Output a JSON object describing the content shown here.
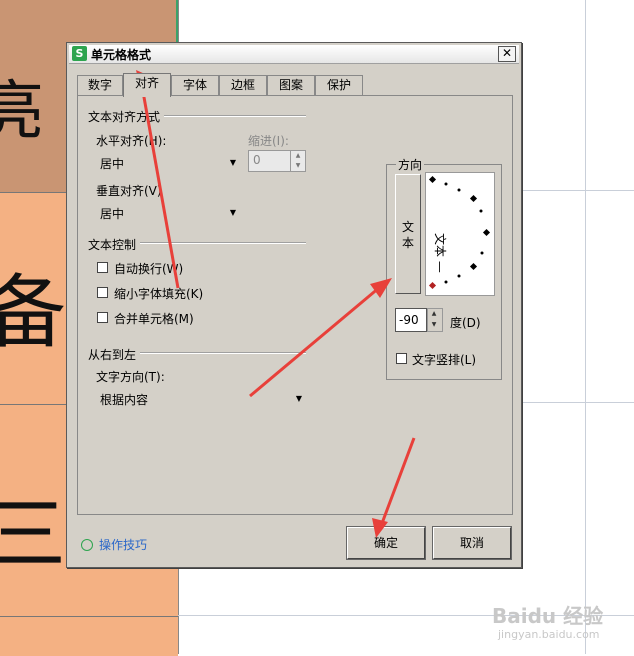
{
  "background": {
    "cells": [
      "亮",
      "备",
      "三"
    ]
  },
  "dialog": {
    "title": "单元格格式",
    "app_icon": "S",
    "close": "✕",
    "tabs": [
      {
        "label": "数字"
      },
      {
        "label": "对齐"
      },
      {
        "label": "字体"
      },
      {
        "label": "边框"
      },
      {
        "label": "图案"
      },
      {
        "label": "保护"
      }
    ],
    "text_alignment": {
      "heading": "文本对齐方式",
      "horizontal_label": "水平对齐(H):",
      "horizontal_value": "居中",
      "indent_label": "缩进(I):",
      "indent_value": "0",
      "vertical_label": "垂直对齐(V)",
      "vertical_value": "居中"
    },
    "text_control": {
      "heading": "文本控制",
      "wrap": "自动换行(W)",
      "shrink": "缩小字体填充(K)",
      "merge": "合并单元格(M)"
    },
    "rtl": {
      "heading": "从右到左",
      "direction_label": "文字方向(T):",
      "direction_value": "根据内容"
    },
    "orientation": {
      "heading": "方向",
      "vertical_text": "文本",
      "dial_text": "文本 —",
      "degrees_value": "-90",
      "degrees_label": "度(D)",
      "vertical_arrange": "文字竖排(L)"
    },
    "tips": "操作技巧",
    "ok": "确定",
    "cancel": "取消"
  },
  "watermark": {
    "brand": "Baidu 经验",
    "url": "jingyan.baidu.com"
  },
  "colors": {
    "cell_top": "#c99573",
    "cell_fill": "#f4b183",
    "arrow": "#e8403a",
    "accent_green": "#2ea44f",
    "link_blue": "#2a67c9"
  }
}
